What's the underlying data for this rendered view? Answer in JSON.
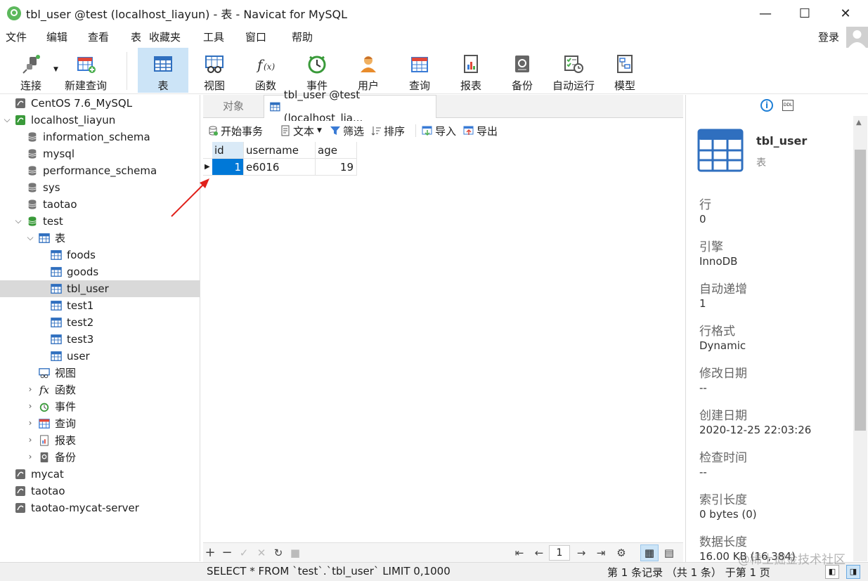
{
  "window": {
    "title": "tbl_user @test (localhost_liayun) - 表 - Navicat for MySQL",
    "minimize": "—",
    "maximize": "☐",
    "close": "✕"
  },
  "menu": [
    "文件",
    "编辑",
    "查看",
    "表",
    "收藏夹",
    "工具",
    "窗口",
    "帮助"
  ],
  "login_label": "登录",
  "toolbar": [
    {
      "label": "连接",
      "icon": "connection-icon"
    },
    {
      "label": "新建查询",
      "icon": "new-query-icon"
    },
    {
      "label": "表",
      "icon": "table-icon",
      "active": true
    },
    {
      "label": "视图",
      "icon": "view-icon"
    },
    {
      "label": "函数",
      "icon": "function-icon"
    },
    {
      "label": "事件",
      "icon": "event-icon"
    },
    {
      "label": "用户",
      "icon": "user-icon"
    },
    {
      "label": "查询",
      "icon": "query-icon"
    },
    {
      "label": "报表",
      "icon": "report-icon"
    },
    {
      "label": "备份",
      "icon": "backup-icon"
    },
    {
      "label": "自动运行",
      "icon": "automation-icon"
    },
    {
      "label": "模型",
      "icon": "model-icon"
    }
  ],
  "tree": {
    "connections_top": [
      "CentOS 7.6_MySQL",
      "localhost_liayun"
    ],
    "databases": [
      "information_schema",
      "mysql",
      "performance_schema",
      "sys",
      "taotao",
      "test"
    ],
    "test_children": {
      "tables_label": "表",
      "tables": [
        "foods",
        "goods",
        "tbl_user",
        "test1",
        "test2",
        "test3",
        "user"
      ],
      "selected": "tbl_user",
      "view": "视图",
      "function": "函数",
      "event": "事件",
      "query": "查询",
      "report": "报表",
      "backup": "备份"
    },
    "connections_bottom": [
      "mycat",
      "taotao",
      "taotao-mycat-server"
    ]
  },
  "tabs": {
    "objects": "对象",
    "active": "tbl_user @test (localhost_lia..."
  },
  "gridbar": {
    "begin_tx": "开始事务",
    "text": "文本",
    "filter": "筛选",
    "sort": "排序",
    "import": "导入",
    "export": "导出"
  },
  "grid": {
    "columns": [
      "id",
      "username",
      "age"
    ],
    "rows": [
      [
        "1",
        "e6016",
        "19"
      ]
    ]
  },
  "nav": {
    "page": "1"
  },
  "status": {
    "sql": "SELECT * FROM `test`.`tbl_user` LIMIT 0,1000",
    "records": "第 1 条记录 （共 1 条） 于第 1 页"
  },
  "info": {
    "name": "tbl_user",
    "type": "表",
    "props": [
      {
        "label": "行",
        "value": "0"
      },
      {
        "label": "引擎",
        "value": "InnoDB"
      },
      {
        "label": "自动递增",
        "value": "1"
      },
      {
        "label": "行格式",
        "value": "Dynamic"
      },
      {
        "label": "修改日期",
        "value": "--"
      },
      {
        "label": "创建日期",
        "value": "2020-12-25 22:03:26"
      },
      {
        "label": "检查时间",
        "value": "--"
      },
      {
        "label": "索引长度",
        "value": "0 bytes (0)"
      },
      {
        "label": "数据长度",
        "value": "16.00 KB (16,384)"
      }
    ]
  },
  "watermark": "@稀土掘金技术社区",
  "colors": {
    "accent": "#1e7fd6",
    "selection": "#0078d7",
    "tree_selected": "#d9d9d9",
    "toolbar_active": "#cce4f7"
  }
}
